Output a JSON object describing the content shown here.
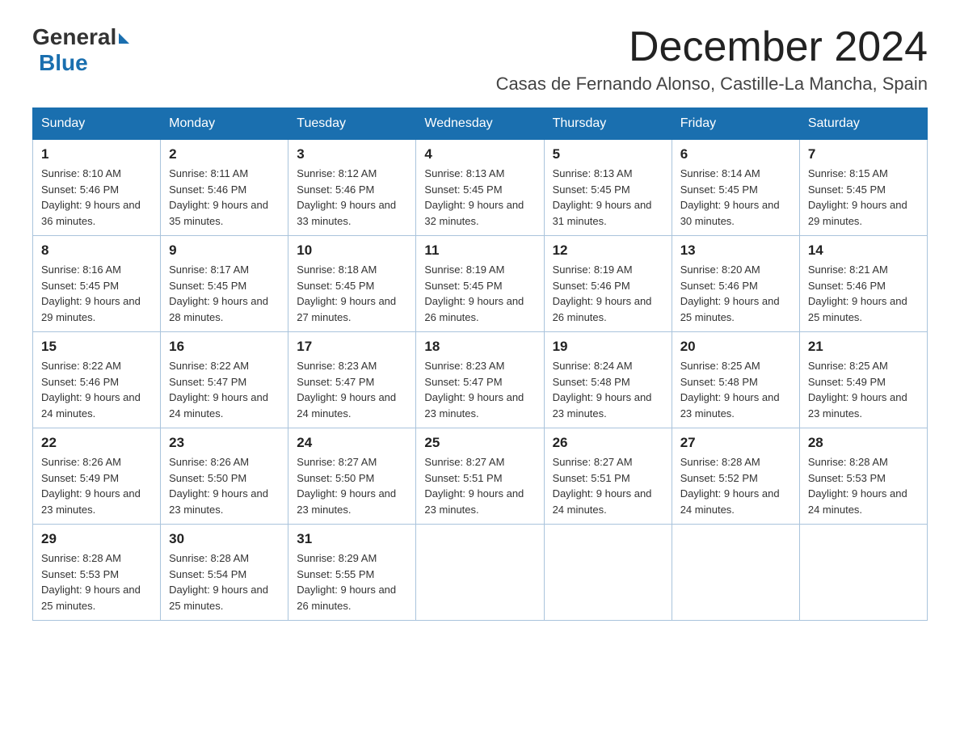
{
  "header": {
    "logo_general": "General",
    "logo_blue": "Blue",
    "month_title": "December 2024",
    "location": "Casas de Fernando Alonso, Castille-La Mancha, Spain"
  },
  "weekdays": [
    "Sunday",
    "Monday",
    "Tuesday",
    "Wednesday",
    "Thursday",
    "Friday",
    "Saturday"
  ],
  "weeks": [
    [
      {
        "day": "1",
        "sunrise": "Sunrise: 8:10 AM",
        "sunset": "Sunset: 5:46 PM",
        "daylight": "Daylight: 9 hours and 36 minutes."
      },
      {
        "day": "2",
        "sunrise": "Sunrise: 8:11 AM",
        "sunset": "Sunset: 5:46 PM",
        "daylight": "Daylight: 9 hours and 35 minutes."
      },
      {
        "day": "3",
        "sunrise": "Sunrise: 8:12 AM",
        "sunset": "Sunset: 5:46 PM",
        "daylight": "Daylight: 9 hours and 33 minutes."
      },
      {
        "day": "4",
        "sunrise": "Sunrise: 8:13 AM",
        "sunset": "Sunset: 5:45 PM",
        "daylight": "Daylight: 9 hours and 32 minutes."
      },
      {
        "day": "5",
        "sunrise": "Sunrise: 8:13 AM",
        "sunset": "Sunset: 5:45 PM",
        "daylight": "Daylight: 9 hours and 31 minutes."
      },
      {
        "day": "6",
        "sunrise": "Sunrise: 8:14 AM",
        "sunset": "Sunset: 5:45 PM",
        "daylight": "Daylight: 9 hours and 30 minutes."
      },
      {
        "day": "7",
        "sunrise": "Sunrise: 8:15 AM",
        "sunset": "Sunset: 5:45 PM",
        "daylight": "Daylight: 9 hours and 29 minutes."
      }
    ],
    [
      {
        "day": "8",
        "sunrise": "Sunrise: 8:16 AM",
        "sunset": "Sunset: 5:45 PM",
        "daylight": "Daylight: 9 hours and 29 minutes."
      },
      {
        "day": "9",
        "sunrise": "Sunrise: 8:17 AM",
        "sunset": "Sunset: 5:45 PM",
        "daylight": "Daylight: 9 hours and 28 minutes."
      },
      {
        "day": "10",
        "sunrise": "Sunrise: 8:18 AM",
        "sunset": "Sunset: 5:45 PM",
        "daylight": "Daylight: 9 hours and 27 minutes."
      },
      {
        "day": "11",
        "sunrise": "Sunrise: 8:19 AM",
        "sunset": "Sunset: 5:45 PM",
        "daylight": "Daylight: 9 hours and 26 minutes."
      },
      {
        "day": "12",
        "sunrise": "Sunrise: 8:19 AM",
        "sunset": "Sunset: 5:46 PM",
        "daylight": "Daylight: 9 hours and 26 minutes."
      },
      {
        "day": "13",
        "sunrise": "Sunrise: 8:20 AM",
        "sunset": "Sunset: 5:46 PM",
        "daylight": "Daylight: 9 hours and 25 minutes."
      },
      {
        "day": "14",
        "sunrise": "Sunrise: 8:21 AM",
        "sunset": "Sunset: 5:46 PM",
        "daylight": "Daylight: 9 hours and 25 minutes."
      }
    ],
    [
      {
        "day": "15",
        "sunrise": "Sunrise: 8:22 AM",
        "sunset": "Sunset: 5:46 PM",
        "daylight": "Daylight: 9 hours and 24 minutes."
      },
      {
        "day": "16",
        "sunrise": "Sunrise: 8:22 AM",
        "sunset": "Sunset: 5:47 PM",
        "daylight": "Daylight: 9 hours and 24 minutes."
      },
      {
        "day": "17",
        "sunrise": "Sunrise: 8:23 AM",
        "sunset": "Sunset: 5:47 PM",
        "daylight": "Daylight: 9 hours and 24 minutes."
      },
      {
        "day": "18",
        "sunrise": "Sunrise: 8:23 AM",
        "sunset": "Sunset: 5:47 PM",
        "daylight": "Daylight: 9 hours and 23 minutes."
      },
      {
        "day": "19",
        "sunrise": "Sunrise: 8:24 AM",
        "sunset": "Sunset: 5:48 PM",
        "daylight": "Daylight: 9 hours and 23 minutes."
      },
      {
        "day": "20",
        "sunrise": "Sunrise: 8:25 AM",
        "sunset": "Sunset: 5:48 PM",
        "daylight": "Daylight: 9 hours and 23 minutes."
      },
      {
        "day": "21",
        "sunrise": "Sunrise: 8:25 AM",
        "sunset": "Sunset: 5:49 PM",
        "daylight": "Daylight: 9 hours and 23 minutes."
      }
    ],
    [
      {
        "day": "22",
        "sunrise": "Sunrise: 8:26 AM",
        "sunset": "Sunset: 5:49 PM",
        "daylight": "Daylight: 9 hours and 23 minutes."
      },
      {
        "day": "23",
        "sunrise": "Sunrise: 8:26 AM",
        "sunset": "Sunset: 5:50 PM",
        "daylight": "Daylight: 9 hours and 23 minutes."
      },
      {
        "day": "24",
        "sunrise": "Sunrise: 8:27 AM",
        "sunset": "Sunset: 5:50 PM",
        "daylight": "Daylight: 9 hours and 23 minutes."
      },
      {
        "day": "25",
        "sunrise": "Sunrise: 8:27 AM",
        "sunset": "Sunset: 5:51 PM",
        "daylight": "Daylight: 9 hours and 23 minutes."
      },
      {
        "day": "26",
        "sunrise": "Sunrise: 8:27 AM",
        "sunset": "Sunset: 5:51 PM",
        "daylight": "Daylight: 9 hours and 24 minutes."
      },
      {
        "day": "27",
        "sunrise": "Sunrise: 8:28 AM",
        "sunset": "Sunset: 5:52 PM",
        "daylight": "Daylight: 9 hours and 24 minutes."
      },
      {
        "day": "28",
        "sunrise": "Sunrise: 8:28 AM",
        "sunset": "Sunset: 5:53 PM",
        "daylight": "Daylight: 9 hours and 24 minutes."
      }
    ],
    [
      {
        "day": "29",
        "sunrise": "Sunrise: 8:28 AM",
        "sunset": "Sunset: 5:53 PM",
        "daylight": "Daylight: 9 hours and 25 minutes."
      },
      {
        "day": "30",
        "sunrise": "Sunrise: 8:28 AM",
        "sunset": "Sunset: 5:54 PM",
        "daylight": "Daylight: 9 hours and 25 minutes."
      },
      {
        "day": "31",
        "sunrise": "Sunrise: 8:29 AM",
        "sunset": "Sunset: 5:55 PM",
        "daylight": "Daylight: 9 hours and 26 minutes."
      },
      null,
      null,
      null,
      null
    ]
  ]
}
